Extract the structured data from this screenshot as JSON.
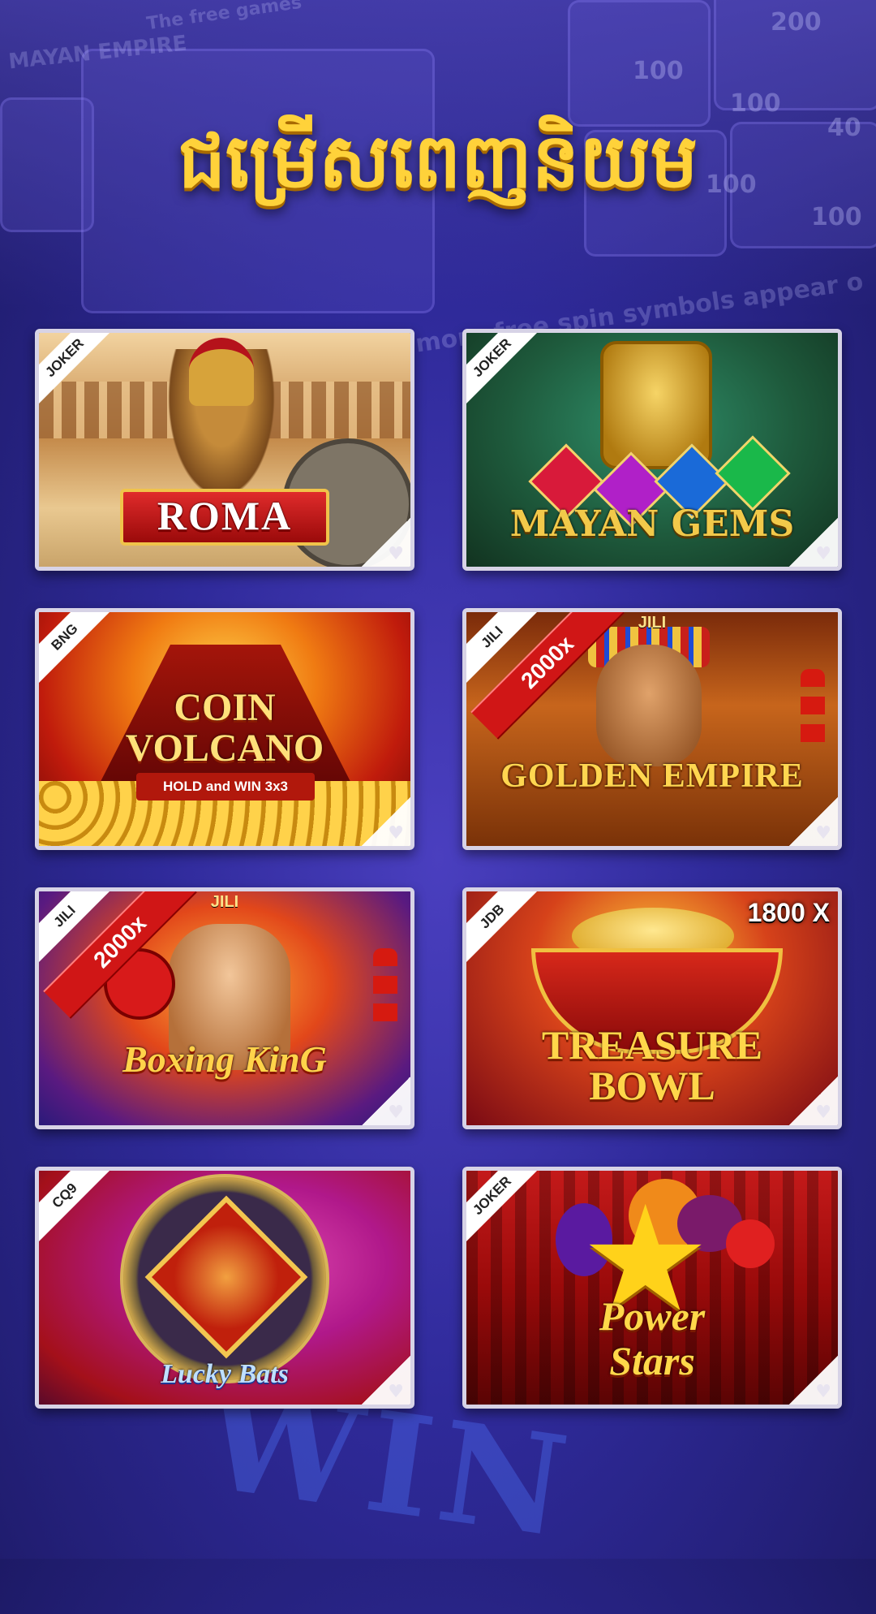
{
  "page": {
    "title": "ជម្រើសពេញនិយម",
    "background_colors": {
      "primary": "#2f2a9a",
      "accent": "#ffd23a"
    }
  },
  "games": [
    {
      "name": "ROMA",
      "provider": "JOKER",
      "multiplier": "",
      "logo_lines": [
        "ROMA"
      ],
      "favorite_icon": "heart-icon"
    },
    {
      "name": "MAYAN GEMS",
      "provider": "JOKER",
      "multiplier": "",
      "logo_lines": [
        "MAYAN GEMS"
      ],
      "favorite_icon": "heart-icon"
    },
    {
      "name": "COIN VOLCANO",
      "provider": "BNG",
      "multiplier": "",
      "logo_lines": [
        "COIN",
        "VOLCANO"
      ],
      "subtitle": "HOLD and WIN 3x3",
      "favorite_icon": "heart-icon"
    },
    {
      "name": "GOLDEN EMPIRE",
      "provider": "JILI",
      "multiplier": "2000x",
      "brand": "JILI",
      "logo_lines": [
        "GOLDEN EMPIRE"
      ],
      "favorite_icon": "heart-icon"
    },
    {
      "name": "Boxing KinG",
      "provider": "JILI",
      "multiplier": "2000x",
      "brand": "JILI",
      "logo_lines": [
        "Boxing KinG"
      ],
      "favorite_icon": "heart-icon"
    },
    {
      "name": "TREASURE BOWL",
      "provider": "JDB",
      "multiplier": "1800 X",
      "logo_lines": [
        "TREASURE",
        "BOWL"
      ],
      "favorite_icon": "heart-icon"
    },
    {
      "name": "Lucky Bats",
      "provider": "CQ9",
      "multiplier": "",
      "logo_lines": [
        "Lucky Bats"
      ],
      "favorite_icon": "heart-icon"
    },
    {
      "name": "Power Stars",
      "provider": "JOKER",
      "multiplier": "",
      "logo_lines": [
        "Power",
        "Stars"
      ],
      "favorite_icon": "heart-icon"
    }
  ],
  "background": {
    "banner_text": "The free games",
    "tile_values": [
      "200",
      "100",
      "100",
      "40",
      "100",
      "100"
    ],
    "strip_text": "y more free spin symbols appear o",
    "big_text": "WIN",
    "corner_text": "MAYAN EMPIRE"
  }
}
